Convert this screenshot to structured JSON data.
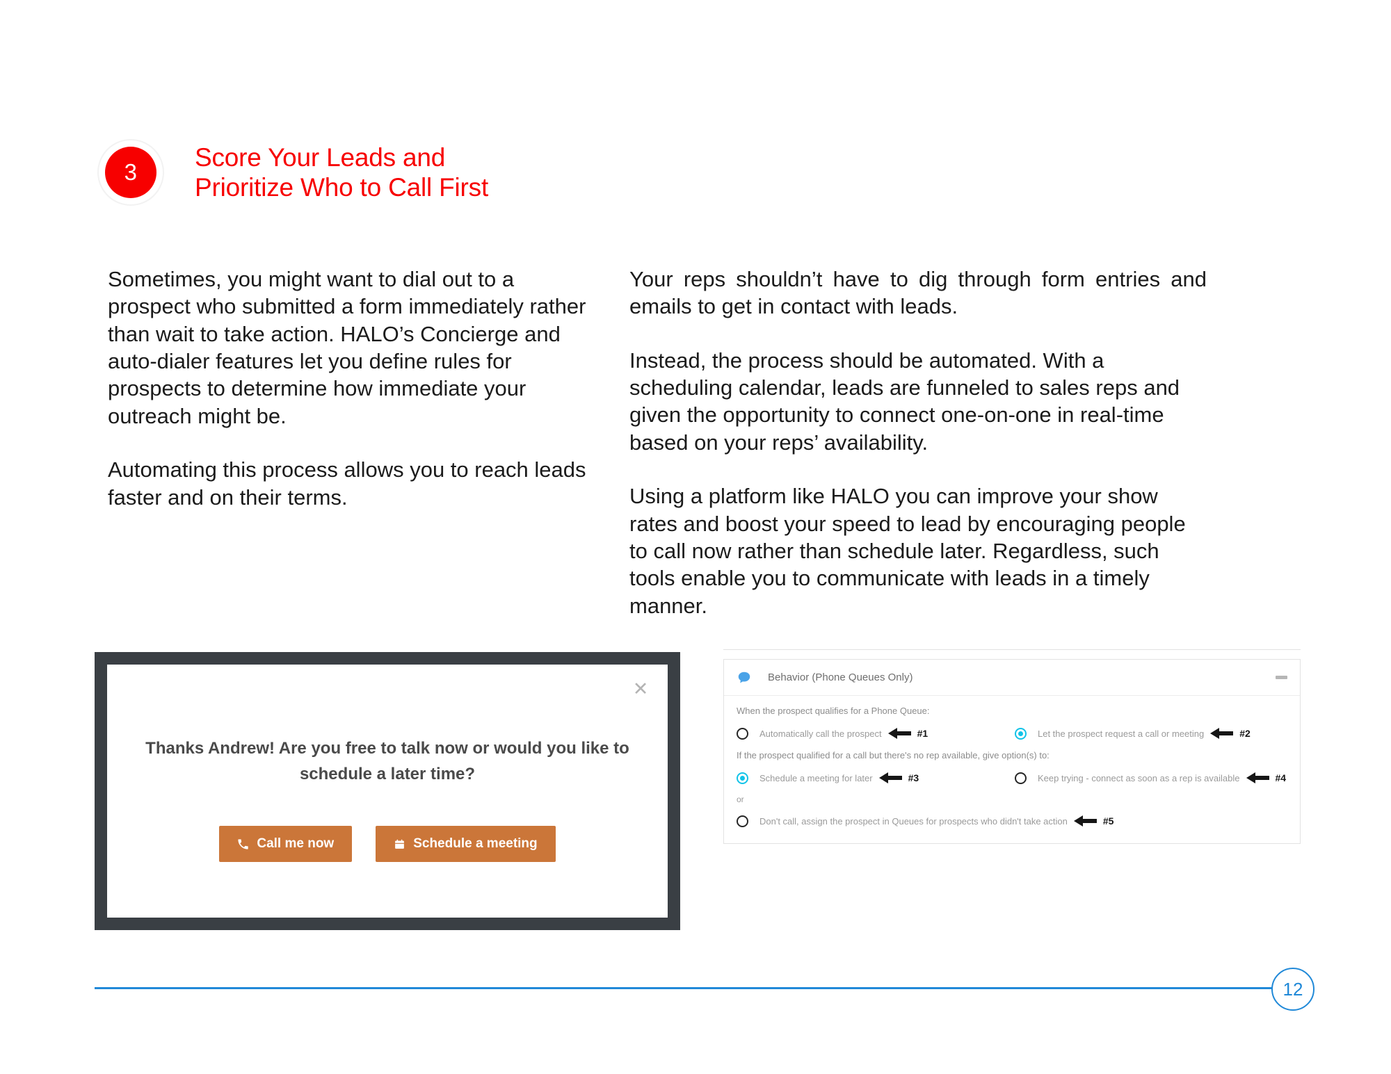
{
  "section": {
    "step_number": "3",
    "title": "Score Your Leads and\nPrioritize Who to Call First",
    "accent_color": "#f70000"
  },
  "body": {
    "left_column": [
      "Sometimes, you might want to dial out to a prospect who submitted a form immediately rather than wait to take action. HALO’s Concierge and auto-dialer features let you define rules for prospects to determine how immediate your outreach might be.",
      "Automating this process allows you to reach leads faster and on their terms."
    ],
    "right_column": [
      "Your reps shouldn’t have to dig through form entries and emails to get in contact with leads.",
      "Instead, the process should be automated. With a scheduling calendar, leads are funneled to sales reps and given the opportunity to connect one-on-one in real-time based on your reps’ availability.",
      "Using a platform like HALO you can improve your show rates and boost your speed to lead by encouraging people to call now rather than schedule later. Regardless, such tools enable you to communicate with leads in a timely manner."
    ]
  },
  "modal_screenshot": {
    "question": "Thanks Andrew! Are you free to talk now or would you like to schedule a later time?",
    "close_icon": "close-icon",
    "buttons": [
      {
        "label": "Call me now",
        "icon": "phone-icon",
        "color": "#cb7639"
      },
      {
        "label": "Schedule a meeting",
        "icon": "calendar-icon",
        "color": "#cb7639"
      }
    ],
    "frame_color": "#3a3f44"
  },
  "behavior_panel": {
    "icon": "speech-bubble-icon",
    "title": "Behavior (Phone Queues Only)",
    "minimize_icon": "minimize-icon",
    "prompt_1": "When the prospect qualifies for a Phone Queue:",
    "prompt_2": "If the prospect qualified for a call but there's no rep available, give option(s) to:",
    "or_label": "or",
    "selected_color": "#12c3e8",
    "options_row_1": [
      {
        "label": "Automatically call the prospect",
        "selected": false,
        "callout": "#1"
      },
      {
        "label": "Let the prospect request a call or meeting",
        "selected": true,
        "callout": "#2"
      }
    ],
    "options_row_2": [
      {
        "label": "Schedule a meeting for later",
        "selected": true,
        "callout": "#3"
      },
      {
        "label": "Keep trying - connect as soon as a rep is available",
        "selected": false,
        "callout": "#4"
      }
    ],
    "options_row_3": [
      {
        "label": "Don't call, assign the prospect in Queues for prospects who didn't take action",
        "selected": false,
        "callout": "#5"
      }
    ]
  },
  "footer": {
    "page_number": "12",
    "rule_color": "#2089d8"
  }
}
